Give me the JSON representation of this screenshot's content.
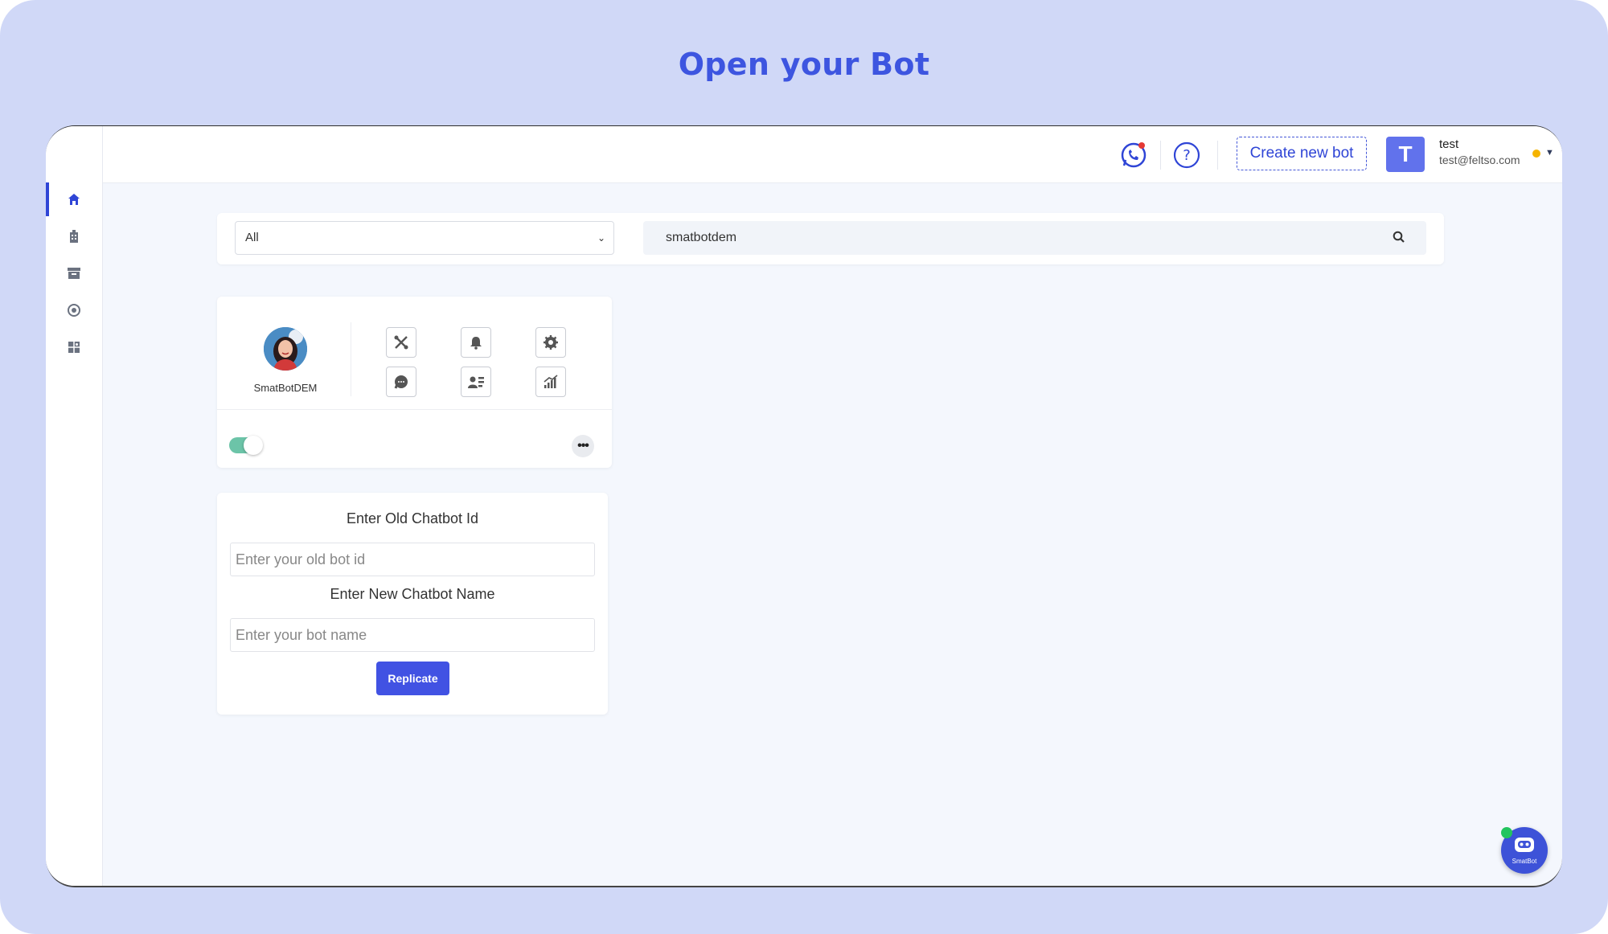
{
  "banner": {
    "title": "Open your Bot"
  },
  "sidebar": {
    "items": [
      {
        "icon": "home-icon",
        "active": true
      },
      {
        "icon": "building-icon",
        "active": false
      },
      {
        "icon": "archive-icon",
        "active": false
      },
      {
        "icon": "support-icon",
        "active": false
      },
      {
        "icon": "integrations-icon",
        "active": false
      }
    ]
  },
  "header": {
    "whatsapp_icon": "whatsapp-icon",
    "help_icon": "help-icon",
    "create_bot_label": "Create new bot",
    "user": {
      "initial": "T",
      "name": "test",
      "email": "test@feltso.com",
      "status_color": "#f5b400"
    }
  },
  "filter": {
    "select_value": "All",
    "search_value": "smatbotdem"
  },
  "bot_card": {
    "name": "SmatBotDEM",
    "tools": [
      "tools-icon",
      "bell-icon",
      "settings-icon",
      "chat-icon",
      "users-icon",
      "analytics-icon"
    ],
    "enabled": true
  },
  "replicate": {
    "old_id_label": "Enter Old Chatbot Id",
    "old_id_placeholder": "Enter your old bot id",
    "new_name_label": "Enter New Chatbot Name",
    "new_name_placeholder": "Enter your bot name",
    "button_label": "Replicate"
  },
  "chat_widget": {
    "label": "SmatBot"
  },
  "colors": {
    "accent": "#3d55e0",
    "frame_bg": "#d0d8f7",
    "toggle_on": "#6cc4a8"
  }
}
